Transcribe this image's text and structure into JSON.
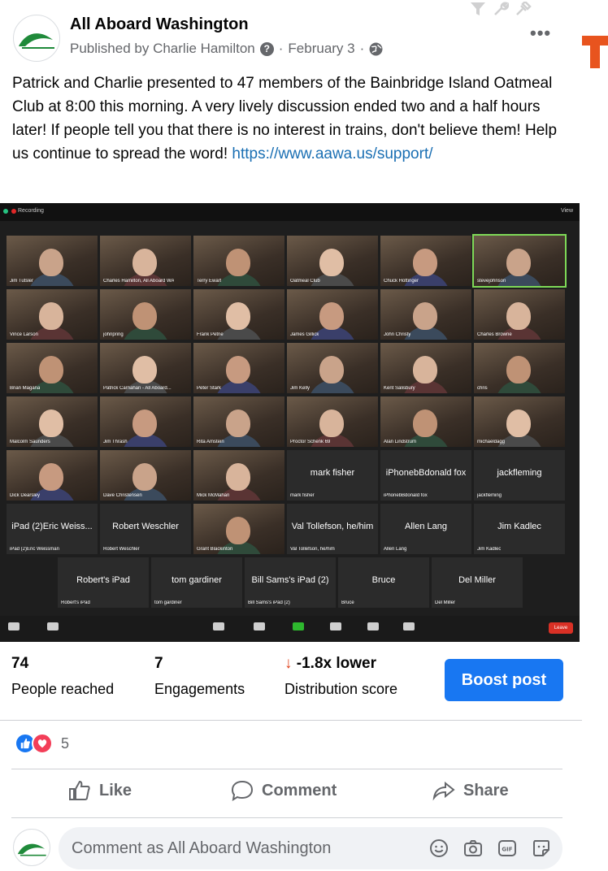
{
  "post": {
    "page_name": "All Aboard Washington",
    "published_by": "Published by Charlie Hamilton",
    "date": "February 3",
    "sep": "·",
    "body_text": "Patrick and Charlie presented to 47 members of the Bainbridge Island Oatmeal Club at 8:00 this morning. A very lively discussion ended two and a half hours later! If people tell you that there is no interest in trains, don't believe them! Help us continue to spread the word!",
    "link": "https://www.aawa.us/support/"
  },
  "zoom": {
    "recording_label": "Recording",
    "view_label": "View",
    "leave_label": "Leave",
    "tiles": [
      {
        "name": "Jim Tutsler",
        "kind": "video"
      },
      {
        "name": "Charles Hamilton, All Aboard WA",
        "kind": "video"
      },
      {
        "name": "Terry Ewart",
        "kind": "video"
      },
      {
        "name": "Oatmeal Club",
        "kind": "video"
      },
      {
        "name": "Chuck Hottinger",
        "kind": "video"
      },
      {
        "name": "stevejohnson",
        "kind": "video"
      },
      {
        "name": "Vince Larson",
        "kind": "video"
      },
      {
        "name": "johnpring",
        "kind": "video"
      },
      {
        "name": "Frank Petrie",
        "kind": "video"
      },
      {
        "name": "James Gillick",
        "kind": "video"
      },
      {
        "name": "John Christy",
        "kind": "video"
      },
      {
        "name": "Charles Browne",
        "kind": "video"
      },
      {
        "name": "Brian Magana",
        "kind": "video"
      },
      {
        "name": "Patrick Carnahan - All Aboard...",
        "kind": "video"
      },
      {
        "name": "Peter Stark",
        "kind": "video"
      },
      {
        "name": "Jim Kelly",
        "kind": "video"
      },
      {
        "name": "Kent Salisbury",
        "kind": "video"
      },
      {
        "name": "chris",
        "kind": "video"
      },
      {
        "name": "Malcolm Saunders",
        "kind": "video"
      },
      {
        "name": "Jim Thrash",
        "kind": "video"
      },
      {
        "name": "Rita Amstein",
        "kind": "video"
      },
      {
        "name": "Proctor Schenk 69",
        "kind": "video"
      },
      {
        "name": "Alan Lindstrum",
        "kind": "video"
      },
      {
        "name": "michaeldagg",
        "kind": "video"
      },
      {
        "name": "Dick Dearsley",
        "kind": "video"
      },
      {
        "name": "Dave Christensen",
        "kind": "video"
      },
      {
        "name": "Mick McMahan",
        "kind": "video"
      },
      {
        "name": "mark fisher",
        "kind": "blank",
        "big": "mark fisher"
      },
      {
        "name": "iPhonebBdonald fox",
        "kind": "blank",
        "big": "iPhonebBdonald fox"
      },
      {
        "name": "jackfleming",
        "kind": "blank",
        "big": "jackfleming"
      },
      {
        "name": "iPad (2)Eric Weissman",
        "kind": "blank",
        "big": "iPad (2)Eric Weiss..."
      },
      {
        "name": "Robert Weschler",
        "kind": "blank",
        "big": "Robert Weschler"
      },
      {
        "name": "Grant Blackinton",
        "kind": "video"
      },
      {
        "name": "Val Tollefson, he/him",
        "kind": "blank",
        "big": "Val Tollefson, he/him"
      },
      {
        "name": "Allen Lang",
        "kind": "blank",
        "big": "Allen Lang"
      },
      {
        "name": "Jim Kadlec",
        "kind": "blank",
        "big": "Jim Kadlec"
      },
      {
        "name": "Robert's iPad",
        "kind": "blank",
        "big": "Robert's iPad"
      },
      {
        "name": "tom gardiner",
        "kind": "blank",
        "big": "tom gardiner"
      },
      {
        "name": "Bill Sams's iPad (2)",
        "kind": "blank",
        "big": "Bill Sams's iPad (2)"
      },
      {
        "name": "Bruce",
        "kind": "blank",
        "big": "Bruce"
      },
      {
        "name": "Del Miller",
        "kind": "blank",
        "big": "Del Miller"
      }
    ]
  },
  "insights": {
    "reached_value": "74",
    "reached_label": "People reached",
    "engagements_value": "7",
    "engagements_label": "Engagements",
    "distribution_value": "-1.8x lower",
    "distribution_label": "Distribution score",
    "boost_label": "Boost post"
  },
  "reactions": {
    "count": "5"
  },
  "actions": {
    "like": "Like",
    "comment": "Comment",
    "share": "Share"
  },
  "composer": {
    "placeholder": "Comment as All Aboard Washington"
  },
  "colors": {
    "accent": "#1877f2",
    "logo_green": "#1f8a3a",
    "down_arrow": "#e0421c"
  }
}
